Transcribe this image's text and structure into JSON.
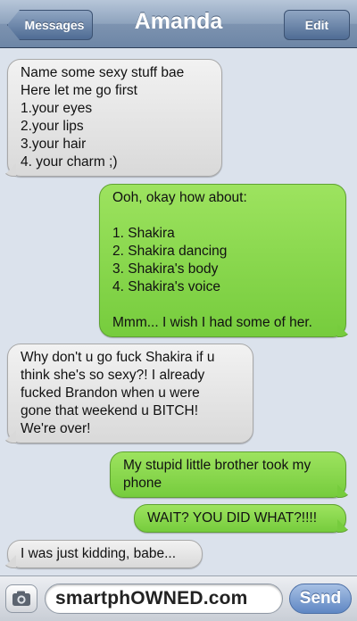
{
  "navbar": {
    "back_label": "Messages",
    "title": "Amanda",
    "edit_label": "Edit"
  },
  "messages": [
    {
      "direction": "incoming",
      "text": "Name some sexy stuff bae\nHere let me go first\n1.your eyes\n2.your lips\n3.your hair\n4. your charm ;)"
    },
    {
      "direction": "outgoing",
      "text": "Ooh, okay how about:\n\n1. Shakira\n2. Shakira dancing\n3. Shakira's body\n4. Shakira's voice\n\nMmm... I wish I had some of her."
    },
    {
      "direction": "incoming",
      "text": "Why don't u go fuck Shakira if u\nthink she's so sexy?! I already\nfucked Brandon when u were\ngone that weekend u BITCH!\nWe're over!"
    },
    {
      "direction": "outgoing",
      "text": "My stupid little brother took my\nphone"
    },
    {
      "direction": "outgoing",
      "text": "WAIT? YOU DID WHAT?!!!!"
    },
    {
      "direction": "incoming",
      "text": "I was just kidding, babe..."
    }
  ],
  "input_bar": {
    "camera_icon": "camera-icon",
    "field_value": "smartphOWNED.com",
    "send_label": "Send"
  },
  "colors": {
    "incoming_bubble": "#e4e4e4",
    "outgoing_bubble": "#85d64a",
    "background": "#dbe2ec",
    "nav_bar": "#7d93b0"
  }
}
